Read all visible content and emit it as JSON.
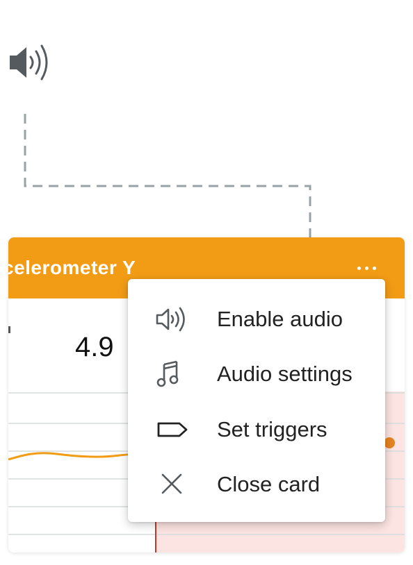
{
  "colors": {
    "accent": "#f29c16",
    "icon_gray": "#555a5e",
    "connector": "#97a3a4",
    "graph_line": "#f29c16",
    "trigger_zone": "#fbe4e2",
    "trigger_line": "#c0392b"
  },
  "top_icon": "speaker-audio-icon",
  "card": {
    "title": "celerometer Y",
    "value": "4.9",
    "menu_icon": "more-horizontal-icon"
  },
  "menu": {
    "items": [
      {
        "label": "Enable audio",
        "icon": "speaker-audio-icon"
      },
      {
        "label": "Audio settings",
        "icon": "music-note-icon"
      },
      {
        "label": "Set triggers",
        "icon": "tag-icon"
      },
      {
        "label": "Close card",
        "icon": "close-icon"
      }
    ]
  }
}
